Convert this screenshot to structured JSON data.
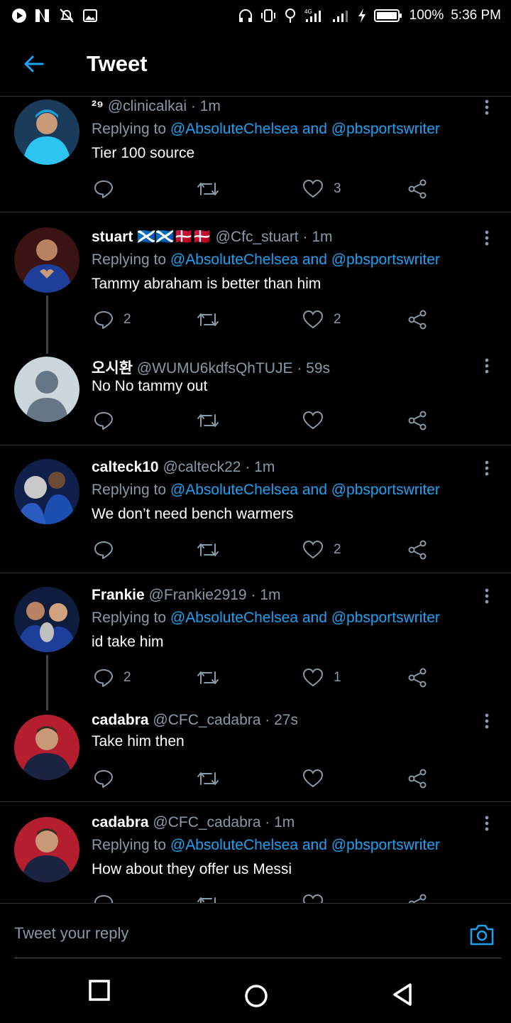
{
  "status": {
    "battery": "100%",
    "time": "5:36 PM",
    "network": "4G"
  },
  "header": {
    "title": "Tweet"
  },
  "tweets": [
    {
      "name": "²⁹",
      "handle": "@clinicalkai",
      "time": "· 1m",
      "replying_prefix": "Replying to",
      "mentions": "@AbsoluteChelsea and @pbsportswriter",
      "text": "Tier 100 source",
      "replies": "",
      "likes": "3"
    },
    {
      "name": "stuart 🏴󠁧󠁢󠁳󠁣󠁴󠁿🏴󠁧󠁢󠁳󠁣󠁴󠁿🇩🇰🇩🇰",
      "handle": "@Cfc_stuart",
      "time": "· 1m",
      "replying_prefix": "Replying to",
      "mentions": "@AbsoluteChelsea and @pbsportswriter",
      "text": "Tammy abraham is better than him",
      "replies": "2",
      "likes": "2"
    },
    {
      "name": "오시환",
      "handle": "@WUMU6kdfsQhTUJE",
      "time": "· 59s",
      "text": "No No tammy out",
      "replies": "",
      "likes": ""
    },
    {
      "name": "calteck10",
      "handle": "@calteck22",
      "time": "· 1m",
      "replying_prefix": "Replying to",
      "mentions": "@AbsoluteChelsea and @pbsportswriter",
      "text": "We don’t need bench warmers",
      "replies": "",
      "likes": "2"
    },
    {
      "name": "Frankie",
      "handle": "@Frankie2919",
      "time": "· 1m",
      "replying_prefix": "Replying to",
      "mentions": "@AbsoluteChelsea and @pbsportswriter",
      "text": "id take him",
      "replies": "2",
      "likes": "1"
    },
    {
      "name": "cadabra",
      "handle": "@CFC_cadabra",
      "time": "· 27s",
      "text": "Take him then",
      "replies": "",
      "likes": ""
    },
    {
      "name": "cadabra",
      "handle": "@CFC_cadabra",
      "time": "· 1m",
      "replying_prefix": "Replying to",
      "mentions": "@AbsoluteChelsea and @pbsportswriter",
      "text": "How about they offer us Messi",
      "replies": "",
      "likes": ""
    }
  ],
  "compose": {
    "placeholder": "Tweet your reply"
  },
  "colors": {
    "accent": "#1da1f2",
    "muted": "#8899a6",
    "background": "#000000",
    "divider": "#2f3336"
  },
  "icons": [
    "back-arrow-icon",
    "more-icon",
    "reply-icon",
    "retweet-icon",
    "like-icon",
    "share-icon",
    "camera-icon",
    "nav-recents-icon",
    "nav-home-icon",
    "nav-back-icon"
  ]
}
